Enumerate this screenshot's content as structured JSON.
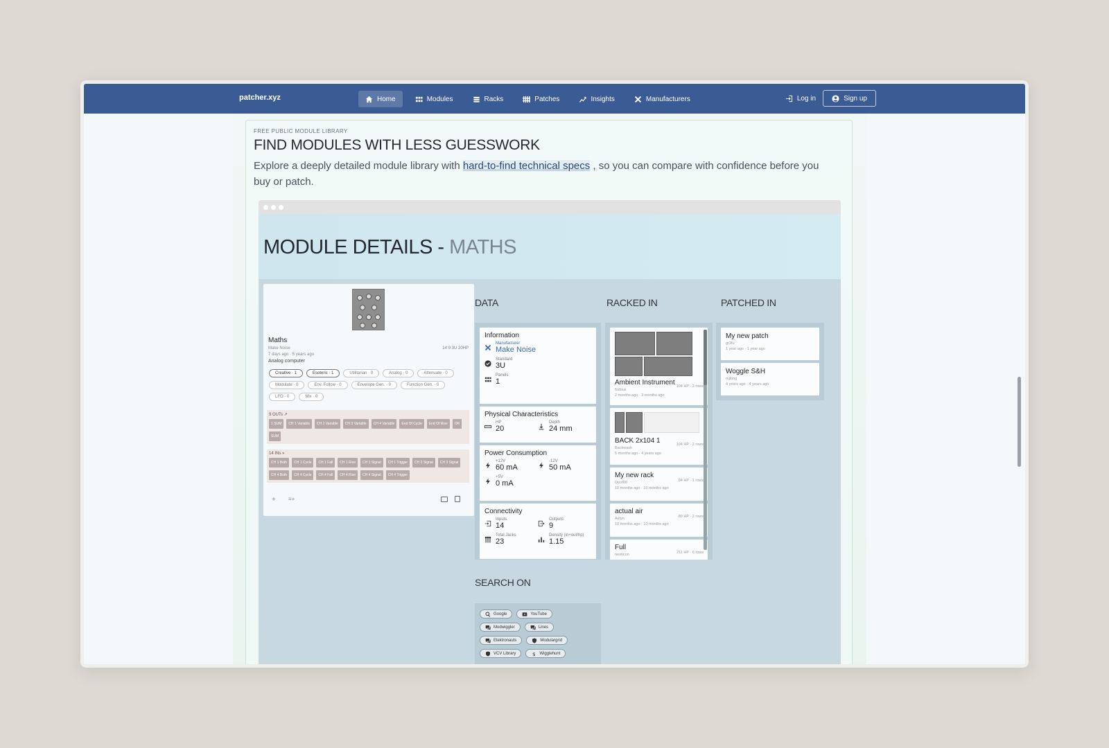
{
  "nav": {
    "brand": "patcher.xyz",
    "links": [
      {
        "label": "Home",
        "icon": "home-icon"
      },
      {
        "label": "Modules",
        "icon": "grid-icon"
      },
      {
        "label": "Racks",
        "icon": "racks-icon"
      },
      {
        "label": "Patches",
        "icon": "patches-icon"
      },
      {
        "label": "Insights",
        "icon": "trend-icon"
      },
      {
        "label": "Manufacturers",
        "icon": "tools-icon"
      }
    ],
    "login": "Log in",
    "signup": "Sign up"
  },
  "hero": {
    "eyebrow": "FREE PUBLIC MODULE LIBRARY",
    "headline": "FIND MODULES WITH LESS GUESSWORK",
    "lede_before": "Explore a deeply detailed module library with ",
    "lede_link": "hard-to-find technical specs",
    "lede_after": " , so you can compare with confidence before you buy or patch."
  },
  "mock": {
    "title": "MODULE DETAILS - ",
    "title_sub": "MATHS",
    "module": {
      "name": "Maths",
      "maker": "Make Noise",
      "dates": "7 days ago · 5 years ago",
      "meta": "14  9  3U 20HP",
      "description": "Analog computer",
      "tags": [
        {
          "label": "Creative · 1",
          "on": true
        },
        {
          "label": "Esoteric · 1",
          "on": true
        },
        {
          "label": "Utilitarian · 0",
          "on": false
        },
        {
          "label": "Analog · 0",
          "on": false
        },
        {
          "label": "Attenuate · 0",
          "on": false
        },
        {
          "label": "Modulate · 0",
          "on": false
        },
        {
          "label": "Env. Follow · 0",
          "on": false
        },
        {
          "label": "Envelope Gen. · 0",
          "on": false
        },
        {
          "label": "Function Gen. · 0",
          "on": false
        },
        {
          "label": "LFO · 0",
          "on": false
        },
        {
          "label": "Mix · 0",
          "on": false
        }
      ],
      "outs_label": "9 OUTs ↗",
      "outs": [
        "1 SUM",
        "CH 1 Variable",
        "CH 2 Variable",
        "CH 3 Variable",
        "CH 4 Variable",
        "End Of Cycle",
        "End Of Rise",
        "OR",
        "SUM"
      ],
      "ins_label": "14 INs »",
      "ins": [
        "CH 1 Both",
        "CH 1 Cycle",
        "CH 1 Fall",
        "CH 1 Rise",
        "CH 1 Signal",
        "CH 1 Trigger",
        "CH 2 Signal",
        "CH 3 Signal",
        "CH 4 Both",
        "CH 4 Cycle",
        "CH 4 Fall",
        "CH 4 Rise",
        "CH 4 Signal",
        "CH 4 Trigger"
      ],
      "foot_add": "+",
      "foot_list": "≡+"
    },
    "sections": {
      "data": "DATA",
      "racked": "RACKED IN",
      "patched": "PATCHED IN",
      "search": "SEARCH ON"
    },
    "data": {
      "information": "Information",
      "manufacturer_label": "Manufacturer",
      "manufacturer": "Make Noise",
      "standard_label": "Standard",
      "standard": "3U",
      "panels_label": "Panels",
      "panels": "1",
      "physical": "Physical Characteristics",
      "hp_label": "HP",
      "hp": "20",
      "depth_label": "Depth",
      "depth": "24 mm",
      "power": "Power Consumption",
      "p12_label": "+12V",
      "p12": "60 mA",
      "m12_label": "-12V",
      "m12": "50 mA",
      "p5_label": "+5V",
      "p5": "0 mA",
      "connectivity": "Connectivity",
      "inputs_label": "Inputs",
      "inputs": "14",
      "outputs_label": "Outputs",
      "outputs": "9",
      "jacks_label": "Total Jacks",
      "jacks": "23",
      "density_label": "Density (in+out/hp)",
      "density": "1.15"
    },
    "racks": [
      {
        "name": "Ambient Instrument",
        "user": "forbius",
        "dates": "2 months ago · 3 months ago",
        "size": "104 HP · 3 rows"
      },
      {
        "name": "BACK 2x104 1",
        "user": "Backwash",
        "dates": "5 months ago · 4 years ago",
        "size": "104 HP · 2 rows"
      },
      {
        "name": "My new rack",
        "user": "Dizzl00",
        "dates": "10 months ago · 10 months ago",
        "size": "84 HP · 1 rows"
      },
      {
        "name": "actual air",
        "user": "Aelyn",
        "dates": "10 months ago · 10 months ago",
        "size": "89 HP · 2 rows"
      },
      {
        "name": "Full",
        "user": "neoticon",
        "dates": "",
        "size": "211 HP · 6 rows"
      }
    ],
    "patches": [
      {
        "name": "My new patch",
        "user": "gr3fu",
        "dates": "1 year ago · 1 year ago"
      },
      {
        "name": "Woggle S&H",
        "user": "mjlong",
        "dates": "4 years ago · 4 years ago"
      }
    ],
    "search": [
      {
        "label": "Google",
        "icon": "search-icon"
      },
      {
        "label": "YouTube",
        "icon": "video-icon"
      },
      {
        "label": "Modwiggler",
        "icon": "chat-icon"
      },
      {
        "label": "Lines",
        "icon": "chat-icon"
      },
      {
        "label": "Elektronauts",
        "icon": "chat-icon"
      },
      {
        "label": "Modulargrid",
        "icon": "shield-icon"
      },
      {
        "label": "VCV Library",
        "icon": "shield-icon"
      },
      {
        "label": "Wigglehunt",
        "icon": "dollar-icon"
      }
    ]
  }
}
